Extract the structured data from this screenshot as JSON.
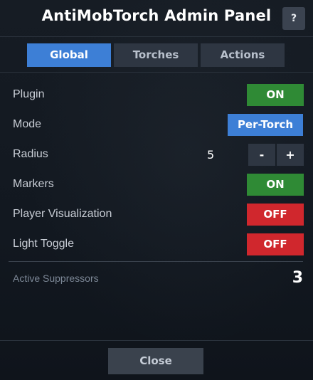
{
  "header": {
    "title": "AntiMobTorch Admin Panel",
    "help_label": "?"
  },
  "tabs": [
    {
      "label": "Global",
      "active": true
    },
    {
      "label": "Torches",
      "active": false
    },
    {
      "label": "Actions",
      "active": false
    }
  ],
  "settings": {
    "plugin": {
      "label": "Plugin",
      "value": "ON"
    },
    "mode": {
      "label": "Mode",
      "value": "Per-Torch"
    },
    "radius": {
      "label": "Radius",
      "value": "5",
      "minus": "-",
      "plus": "+"
    },
    "markers": {
      "label": "Markers",
      "value": "ON"
    },
    "player_visualization": {
      "label": "Player Visualization",
      "value": "OFF"
    },
    "light_toggle": {
      "label": "Light Toggle",
      "value": "OFF"
    }
  },
  "active_suppressors": {
    "label": "Active Suppressors",
    "count": "3"
  },
  "footer": {
    "close_label": "Close"
  },
  "colors": {
    "accent": "#3d7fd6",
    "on": "#2f8a35",
    "off": "#d0272d",
    "panel": "#141a22"
  }
}
